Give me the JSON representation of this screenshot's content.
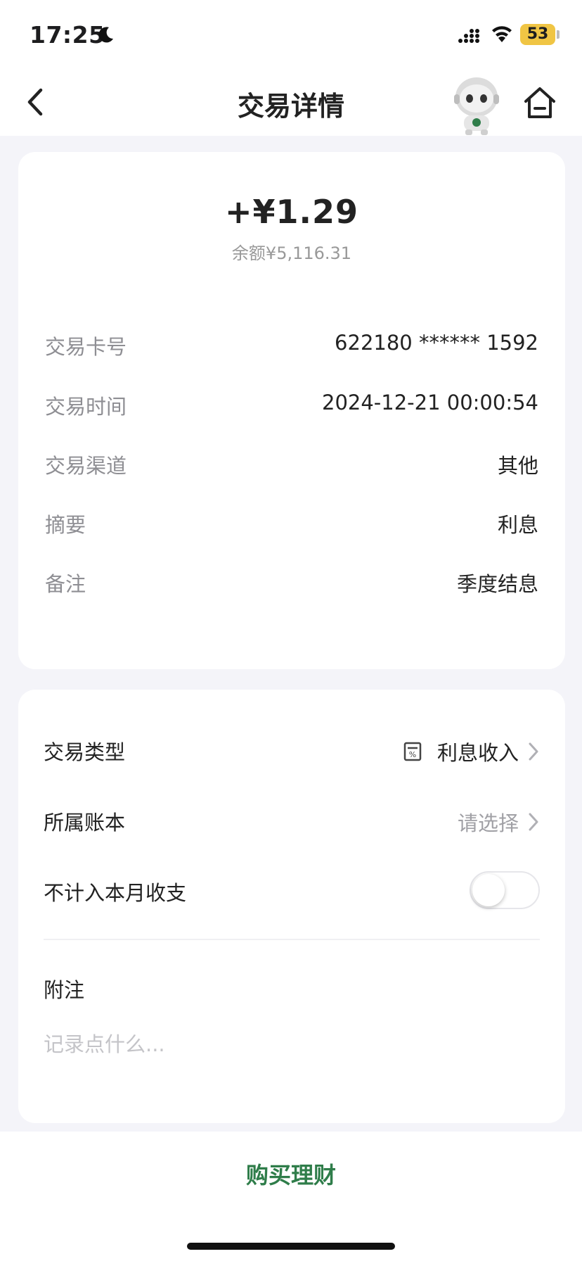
{
  "status_bar": {
    "time": "17:25",
    "battery": "53"
  },
  "nav": {
    "title": "交易详情"
  },
  "transaction": {
    "amount": "+¥1.29",
    "balance": "余额¥5,116.31",
    "rows": [
      {
        "label": "交易卡号",
        "value": "622180 ****** 1592"
      },
      {
        "label": "交易时间",
        "value": "2024-12-21 00:00:54"
      },
      {
        "label": "交易渠道",
        "value": "其他"
      },
      {
        "label": "摘要",
        "value": "利息"
      },
      {
        "label": "备注",
        "value": "季度结息"
      }
    ]
  },
  "settings": {
    "type_label": "交易类型",
    "type_value": "利息收入",
    "ledger_label": "所属账本",
    "ledger_value": "请选择",
    "exclude_label": "不计入本月收支",
    "exclude_enabled": false,
    "note_label": "附注",
    "note_placeholder": "记录点什么..."
  },
  "bottom": {
    "buy_label": "购买理财"
  },
  "colors": {
    "accent_green": "#2f7d4a",
    "battery_yellow": "#f0c544"
  }
}
